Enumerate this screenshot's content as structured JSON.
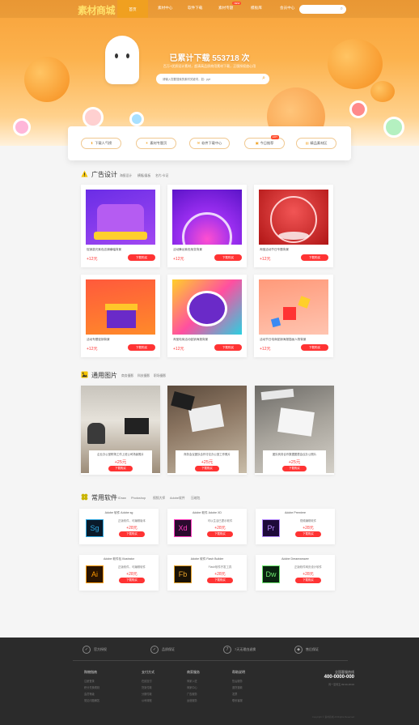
{
  "header": {
    "logo_main": "素材",
    "logo_accent": "商城",
    "tabs": [
      {
        "label": "首页",
        "active": true
      },
      {
        "label": "素材中心"
      },
      {
        "label": "软件下载"
      },
      {
        "label": "素材专题",
        "badge": "NEW"
      },
      {
        "label": "模板库"
      },
      {
        "label": "会员中心"
      }
    ]
  },
  "hero": {
    "title": "已累计下载 553718 次",
    "subtitle": "百万+优质设计素材，超清高品质商用素材下载，正版授权放心用",
    "search_placeholder": "请输入您要搜索的素材关键词，如：ppt"
  },
  "quick_nav": [
    {
      "label": "下载人气榜",
      "icon": "download-icon"
    },
    {
      "label": "素材专题页",
      "icon": "bulb-icon"
    },
    {
      "label": "软件下载中心",
      "icon": "chat-icon"
    },
    {
      "label": "今日推荐",
      "icon": "calendar-icon",
      "badge": "HOT"
    },
    {
      "label": "精品素材区",
      "icon": "folder-icon"
    }
  ],
  "ad_section": {
    "title": "广告设计",
    "tags": [
      "海报设计",
      "横幅/展板",
      "名片/卡证"
    ],
    "items": [
      {
        "name": "促销激光紫色店铺横幅背景",
        "price": "+12元",
        "buy": "下载购买"
      },
      {
        "name": "活动舞台紫色渐变背景",
        "price": "+12元",
        "buy": "下载购买"
      },
      {
        "name": "淘宝活动节日专题背景",
        "price": "+12元",
        "buy": "下载购买"
      },
      {
        "name": "活动专题促销背景",
        "price": "+12元",
        "buy": "下载购买"
      },
      {
        "name": "淘宝电商活动促销海报背景",
        "price": "+12元",
        "buy": "下载购买"
      },
      {
        "name": "活动节日电商促销海报插画人物背景",
        "price": "+12元",
        "buy": "下载购买"
      }
    ]
  },
  "photo_section": {
    "title": "通用图片",
    "tags": [
      "商务摄影",
      "科技摄影",
      "职场摄影"
    ],
    "items": [
      {
        "name": "企业办公室职场工作上班公司场景照片",
        "price": "+25元",
        "buy": "下载购买"
      },
      {
        "name": "商务会议团队合作讨论办公室工作照片",
        "price": "+25元",
        "buy": "下载购买"
      },
      {
        "name": "团队商务合作数据图表会议办公照片",
        "price": "+25元",
        "buy": "下载购买"
      }
    ]
  },
  "software_section": {
    "title": "常用软件",
    "tags": [
      "IDraw",
      "Photoshop",
      "视频大师",
      "Adobe软件",
      "压缩包"
    ],
    "items": [
      {
        "name": "Adobe 软件 Adobe sg",
        "desc": "正版软件，可编辑版本",
        "price": "+28元",
        "buy": "下载购买",
        "code": "Sg",
        "fg": "#2fa8e0",
        "bg": "#0a1a2a"
      },
      {
        "name": "Adobe 软件 Adobe XD",
        "desc": "可以生活已提示软件",
        "price": "+28元",
        "buy": "下载购买",
        "code": "Xd",
        "fg": "#ff3fbf",
        "bg": "#2a0a2e"
      },
      {
        "name": "Adobe Premiere",
        "desc": "视频编辑软件",
        "price": "+28元",
        "buy": "下载购买",
        "code": "Pr",
        "fg": "#b88cff",
        "bg": "#1e0a3a"
      },
      {
        "name": "Adobe 软件包 Illustrator",
        "desc": "正版软件，可编辑软件",
        "price": "+28元",
        "buy": "下载购买",
        "code": "Ai",
        "fg": "#ff9a00",
        "bg": "#2a1400"
      },
      {
        "name": "Adobe 软件 Flash Builder",
        "desc": "Flash软件开发工具",
        "price": "+28元",
        "buy": "下载购买",
        "code": "Fb",
        "fg": "#e8a32a",
        "bg": "#1a1206"
      },
      {
        "name": "Adobe Dreamweaver",
        "desc": "正版软件网页设计软件",
        "price": "+28元",
        "buy": "下载购买",
        "code": "Dw",
        "fg": "#6fe86f",
        "bg": "#0a2410"
      }
    ]
  },
  "footer": {
    "guarantees": [
      {
        "label": "官方授权",
        "icon": "shield-icon",
        "glyph": "✓"
      },
      {
        "label": "品质保证",
        "icon": "shield-icon",
        "glyph": "✓"
      },
      {
        "label": "7天无理由退换",
        "icon": "seven-icon",
        "glyph": "7"
      },
      {
        "label": "售后保证",
        "icon": "badge-icon",
        "glyph": "◆"
      }
    ],
    "columns": [
      {
        "heading": "购物指南",
        "links": [
          "注册登录",
          "积分兑换规则",
          "会员等级",
          "常见问题解答"
        ]
      },
      {
        "heading": "支付方式",
        "links": [
          "在线支付",
          "货到付款",
          "分期付款",
          "公司转账"
        ]
      },
      {
        "heading": "商家服务",
        "links": [
          "商家入驻",
          "商家中心",
          "广告服务",
          "运营服务"
        ]
      },
      {
        "heading": "帮助说明",
        "links": [
          "售后服务",
          "退货退款",
          "发票",
          "联系客服"
        ]
      }
    ],
    "hotline_label": "全国客服热线",
    "hotline": "400-0000-000",
    "hours": "周一至周五 09:00-18:00",
    "copyright": "Copyright © 素材商城 All Rights Reserved"
  },
  "colors": {
    "accent": "#f0a020",
    "price": "#ff3333",
    "footer_bg": "#2b2b2b"
  }
}
